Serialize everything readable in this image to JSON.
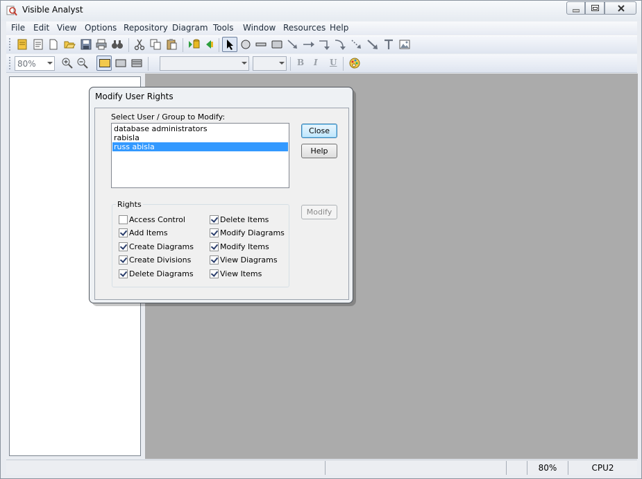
{
  "window": {
    "title": "Visible Analyst"
  },
  "menu": [
    "File",
    "Edit",
    "View",
    "Options",
    "Repository",
    "Diagram",
    "Tools",
    "Window",
    "Resources",
    "Help"
  ],
  "toolbar2": {
    "zoom_value": "80%",
    "bold": "B",
    "italic": "I",
    "underline": "U"
  },
  "dialog": {
    "title": "Modify User Rights",
    "select_label": "Select User / Group to Modify:",
    "users": [
      "database administrators",
      "rabisla",
      "russ abisla"
    ],
    "selected_user": "russ abisla",
    "buttons": {
      "close": "Close",
      "help": "Help",
      "modify": "Modify"
    },
    "rights_label": "Rights",
    "rights_left": [
      {
        "label": "Access Control",
        "checked": false
      },
      {
        "label": "Add Items",
        "checked": true
      },
      {
        "label": "Create Diagrams",
        "checked": true
      },
      {
        "label": "Create Divisions",
        "checked": true
      },
      {
        "label": "Delete Diagrams",
        "checked": true
      }
    ],
    "rights_right": [
      {
        "label": "Delete Items",
        "checked": true
      },
      {
        "label": "Modify Diagrams",
        "checked": true
      },
      {
        "label": "Modify Items",
        "checked": true
      },
      {
        "label": "View Diagrams",
        "checked": true
      },
      {
        "label": "View Items",
        "checked": true
      }
    ]
  },
  "statusbar": {
    "zoom": "80%",
    "cpu": "CPU2"
  },
  "colors": {
    "selection": "#3399ff",
    "workspace": "#ababab",
    "default_button_border": "#3c7fb1"
  }
}
